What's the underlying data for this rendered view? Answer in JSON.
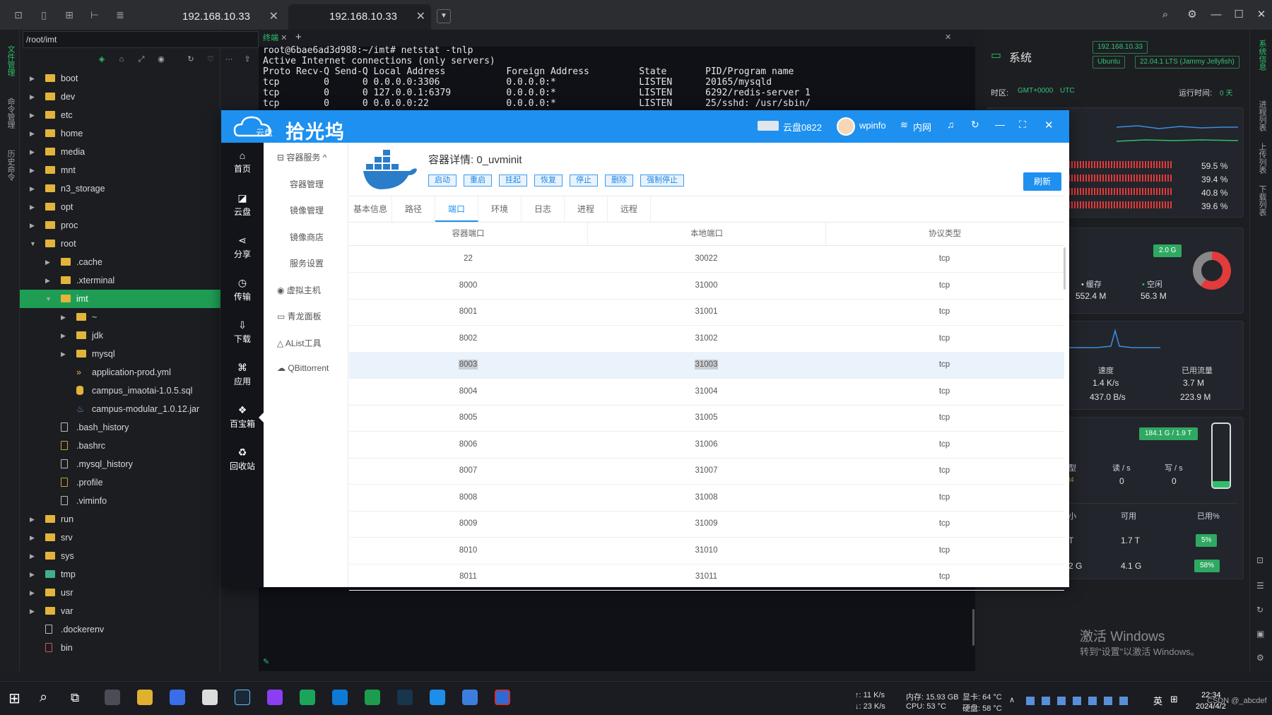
{
  "topbar": {
    "tabs": [
      {
        "label": "192.168.10.33"
      },
      {
        "label": "192.168.10.33"
      }
    ]
  },
  "left_strip": {
    "labels": [
      "文件管理",
      "命令管理",
      "历史命令"
    ]
  },
  "file_tree": {
    "path": "/root/imt",
    "items": [
      {
        "label": "boot"
      },
      {
        "label": "dev"
      },
      {
        "label": "etc"
      },
      {
        "label": "home"
      },
      {
        "label": "media"
      },
      {
        "label": "mnt"
      },
      {
        "label": "n3_storage"
      },
      {
        "label": "opt"
      },
      {
        "label": "proc"
      },
      {
        "label": "root"
      },
      {
        "label": ".cache"
      },
      {
        "label": ".xterminal"
      },
      {
        "label": "imt"
      },
      {
        "label": "~"
      },
      {
        "label": "jdk"
      },
      {
        "label": "mysql"
      },
      {
        "label": "application-prod.yml"
      },
      {
        "label": "campus_imaotai-1.0.5.sql"
      },
      {
        "label": "campus-modular_1.0.12.jar"
      },
      {
        "label": ".bash_history"
      },
      {
        "label": ".bashrc"
      },
      {
        "label": ".mysql_history"
      },
      {
        "label": ".profile"
      },
      {
        "label": ".viminfo"
      },
      {
        "label": "run"
      },
      {
        "label": "srv"
      },
      {
        "label": "sys"
      },
      {
        "label": "tmp"
      },
      {
        "label": "usr"
      },
      {
        "label": "var"
      },
      {
        "label": ".dockerenv"
      },
      {
        "label": "bin"
      }
    ]
  },
  "terminal": {
    "tab_label": "终端",
    "lines": [
      "root@6bae6ad3d988:~/imt# netstat -tnlp",
      "Active Internet connections (only servers)",
      "Proto Recv-Q Send-Q Local Address           Foreign Address         State       PID/Program name",
      "tcp        0      0 0.0.0.0:3306            0.0.0.0:*               LISTEN      20165/mysqld",
      "tcp        0      0 127.0.0.1:6379          0.0.0.0:*               LISTEN      6292/redis-server 1",
      "tcp        0      0 0.0.0.0:22              0.0.0.0:*               LISTEN      25/sshd: /usr/sbin/"
    ]
  },
  "system_panel": {
    "title": "系统",
    "ip": "192.168.10.33",
    "os": "Ubuntu",
    "os_version": "22.04.1 LTS (Jammy Jellyfish)",
    "timezone_label": "时区:",
    "timezone": "GMT+0000",
    "timezone_name": "UTC",
    "uptime_label": "运行时间:",
    "uptime": "0 天",
    "cpu_percents": [
      "59.5 %",
      "39.4 %",
      "40.8 %",
      "39.6 %"
    ],
    "memory_total": "2.0 G",
    "cache_label": "缓存",
    "cache_value": "552.4 M",
    "free_label": "空闲",
    "free_value": "56.3 M",
    "speed_label": "速度",
    "speed_up": "1.4 K/s",
    "speed_down": "437.0 B/s",
    "traffic_label": "已用流量",
    "traffic_up": "3.7 M",
    "traffic_down": "223.9 M",
    "disk_total": "184.1 G / 1.9 T",
    "io_type_label": "型",
    "io_type_value": "t4",
    "read_label": "读 / s",
    "read_value": "0",
    "write_label": "写 / s",
    "write_value": "0",
    "disk_table_headers": [
      "小",
      "可用",
      "已用%"
    ],
    "disk_rows": [
      {
        "size": "T",
        "avail": "1.7 T",
        "used": "5%"
      },
      {
        "size": "2 G",
        "avail": "4.1 G",
        "used": "58%"
      }
    ],
    "watermark_title": "激活 Windows",
    "watermark_sub": "转到\"设置\"以激活 Windows。"
  },
  "right_strip": {
    "labels": [
      "系统信息",
      "进程列表",
      "上传列表",
      "下载列表"
    ]
  },
  "app": {
    "logo_small": "云盘",
    "logo_text": "拾光坞",
    "device": "云盘0822",
    "user": "wpinfo",
    "network": "内网",
    "nav": [
      {
        "label": "首页",
        "icon": "⌂"
      },
      {
        "label": "云盘",
        "icon": "◪"
      },
      {
        "label": "分享",
        "icon": "⋖"
      },
      {
        "label": "传输",
        "icon": "◷"
      },
      {
        "label": "下载",
        "icon": "⇩"
      },
      {
        "label": "应用",
        "icon": "⌘"
      },
      {
        "label": "百宝箱",
        "icon": "❖"
      },
      {
        "label": "回收站",
        "icon": "♻"
      }
    ],
    "side_group": "容器服务",
    "side_items": [
      "容器管理",
      "镜像管理",
      "镜像商店",
      "服务设置"
    ],
    "side_extra": [
      "虚拟主机",
      "青龙面板",
      "AList工具",
      "QBittorrent"
    ],
    "container_title": "容器详情: 0_uvminit",
    "actions": [
      "启动",
      "重启",
      "挂起",
      "恢复",
      "停止",
      "删除",
      "强制停止"
    ],
    "refresh_label": "刷新",
    "subtabs": [
      "基本信息",
      "路径",
      "端口",
      "环境",
      "日志",
      "进程",
      "远程"
    ],
    "active_subtab": "端口",
    "table_headers": [
      "容器端口",
      "本地端口",
      "协议类型"
    ],
    "ports": [
      {
        "container": "22",
        "local": "30022",
        "proto": "tcp"
      },
      {
        "container": "8000",
        "local": "31000",
        "proto": "tcp"
      },
      {
        "container": "8001",
        "local": "31001",
        "proto": "tcp"
      },
      {
        "container": "8002",
        "local": "31002",
        "proto": "tcp"
      },
      {
        "container": "8003",
        "local": "31003",
        "proto": "tcp"
      },
      {
        "container": "8004",
        "local": "31004",
        "proto": "tcp"
      },
      {
        "container": "8005",
        "local": "31005",
        "proto": "tcp"
      },
      {
        "container": "8006",
        "local": "31006",
        "proto": "tcp"
      },
      {
        "container": "8007",
        "local": "31007",
        "proto": "tcp"
      },
      {
        "container": "8008",
        "local": "31008",
        "proto": "tcp"
      },
      {
        "container": "8009",
        "local": "31009",
        "proto": "tcp"
      },
      {
        "container": "8010",
        "local": "31010",
        "proto": "tcp"
      },
      {
        "container": "8011",
        "local": "31011",
        "proto": "tcp"
      }
    ]
  },
  "taskbar": {
    "net_up": "↑: 11 K/s",
    "net_down": "↓: 23 K/s",
    "mem": "内存: 15.93 GB",
    "gpu": "显卡: 64 °C",
    "cpu": "CPU: 53 °C",
    "disk": "硬盘: 58 °C",
    "ime": "英",
    "time": "22:34",
    "date": "2024/4/2",
    "csdn": "CSDN @_abcdef"
  }
}
